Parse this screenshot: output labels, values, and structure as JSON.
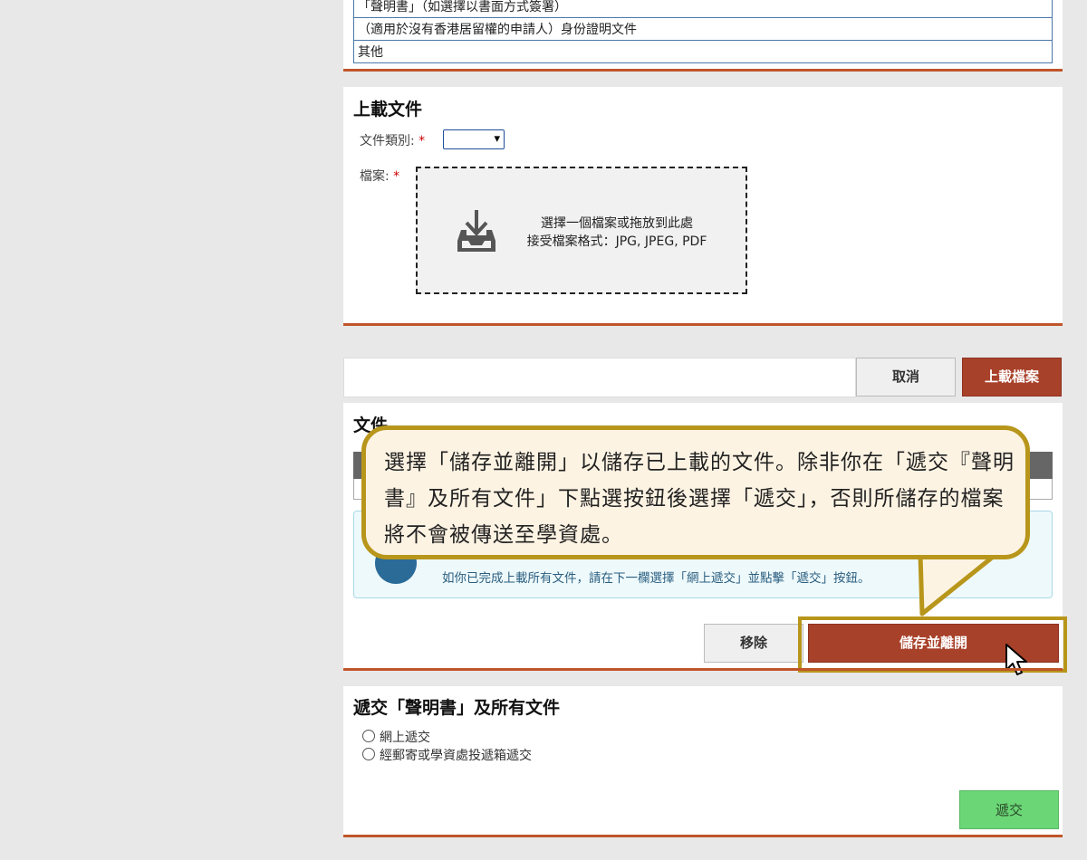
{
  "documents_table": {
    "rows": [
      "「聲明書」（如選擇以書面方式簽署）",
      "（適用於沒有香港居留權的申請人）身份證明文件",
      "其他"
    ]
  },
  "upload": {
    "title": "上載文件",
    "doc_type_label": "文件類別:",
    "file_label": "檔案:",
    "required_mark": "*",
    "dropzone_line1": "選擇一個檔案或拖放到此處",
    "dropzone_line2": "接受檔案格式：JPG, JPEG, PDF",
    "cancel_label": "取消",
    "upload_label": "上載檔案"
  },
  "files": {
    "title": "文件",
    "info_text": "如你已完成上載所有文件，請在下一欄選擇「網上遞交」並點擊「遞交」按鈕。",
    "remove_label": "移除",
    "save_exit_label": "儲存並離開"
  },
  "submit": {
    "title": "遞交「聲明書」及所有文件",
    "option_online": "網上遞交",
    "option_post": "經郵寄或學資處投遞箱遞交",
    "submit_label": "遞交"
  },
  "callout": {
    "text": "選擇「儲存並離開」以儲存已上載的文件。除非你在「遞交『聲明書』及所有文件」下點選按鈕後選擇「遞交」，否則所儲存的檔案將不會被傳送至學資處。"
  },
  "colors": {
    "accent_rust": "#a8412a",
    "callout_border": "#b8961b",
    "submit_green": "#6bd676"
  }
}
